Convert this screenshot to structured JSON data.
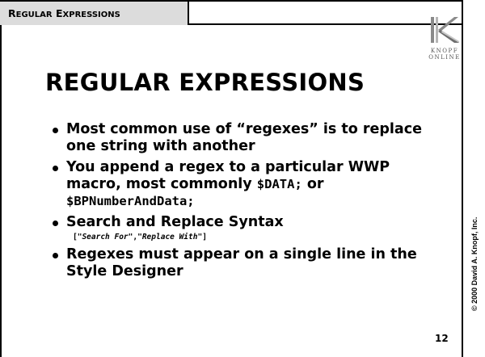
{
  "header": {
    "tab_cap1": "R",
    "tab_rest1": "EGULAR",
    "tab_cap2": "E",
    "tab_rest2": "XPRESSIONS"
  },
  "logo": {
    "wordmark_line1": "KNOPF",
    "wordmark_line2": "ONLINE",
    "icon": "knopf-k-logo"
  },
  "slide": {
    "title": "REGULAR EXPRESSIONS",
    "bullets": {
      "b1": {
        "text": "Most common use of “regexes” is to replace one string with another"
      },
      "b2": {
        "text_before": "You append a regex to a particular WWP macro, most commonly ",
        "code1": "$DATA;",
        "text_mid": " or ",
        "code2": "$BPNumberAndData;"
      },
      "b3": {
        "text": "Search and Replace Syntax",
        "syntax_open": "[\"",
        "syntax_search": "Search For",
        "syntax_mid": "\",\"",
        "syntax_replace": "Replace With",
        "syntax_close": "\"]"
      },
      "b4": {
        "text": "Regexes must appear on a single line in the Style Designer"
      }
    }
  },
  "footer": {
    "copyright": "© 2000 David A. Knopf, Inc.",
    "page_number": "12"
  }
}
